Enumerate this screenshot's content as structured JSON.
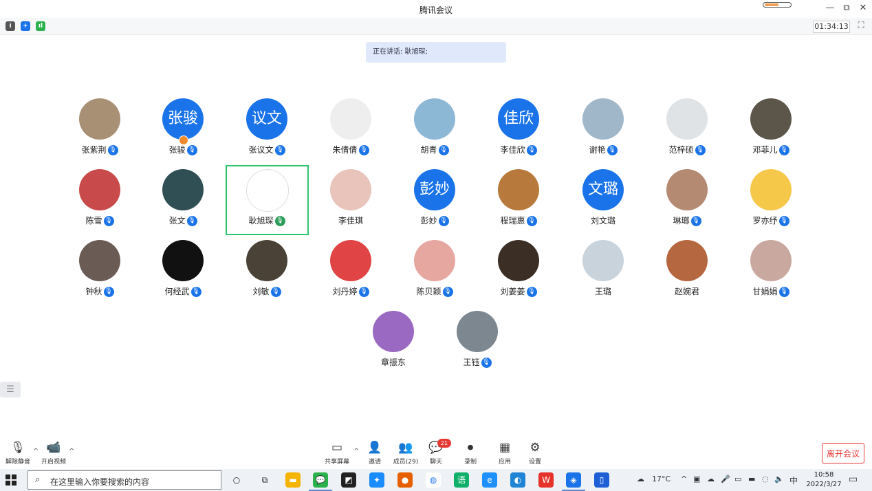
{
  "window": {
    "title": "腾讯会议",
    "controls": {
      "minimize": "—",
      "restore": "⧉",
      "close": "✕"
    }
  },
  "info_bar": {
    "icons": [
      {
        "name": "info-icon",
        "glyph": "i",
        "color": "#555555"
      },
      {
        "name": "shield-icon",
        "glyph": "+",
        "color": "#1a73e8"
      },
      {
        "name": "signal-icon",
        "glyph": "ıl",
        "color": "#2bb24c"
      }
    ],
    "timer": "01:34:13",
    "fullscreen_glyph": "⛶"
  },
  "speaking_banner": "正在讲话: 耿旭琛;",
  "participants": [
    {
      "name": "张紫荆",
      "avatar_text": "",
      "color": "#a89074",
      "mic": true
    },
    {
      "name": "张骏",
      "avatar_text": "张骏",
      "color": "#1a73e8",
      "mic": true,
      "host": true
    },
    {
      "name": "张议文",
      "avatar_text": "议文",
      "color": "#1a73e8",
      "mic": true
    },
    {
      "name": "朱倩倩",
      "avatar_text": "",
      "color": "#eeeeee",
      "mic": true
    },
    {
      "name": "胡青",
      "avatar_text": "",
      "color": "#8cb8d6",
      "mic": true
    },
    {
      "name": "李佳欣",
      "avatar_text": "佳欣",
      "color": "#1a73e8",
      "mic": true
    },
    {
      "name": "谢艳",
      "avatar_text": "",
      "color": "#9fb7c9",
      "mic": true
    },
    {
      "name": "范梓硕",
      "avatar_text": "",
      "color": "#dfe3e6",
      "mic": true
    },
    {
      "name": "邓菲儿",
      "avatar_text": "",
      "color": "#5b5649",
      "mic": true
    },
    {
      "name": "陈雪",
      "avatar_text": "",
      "color": "#c94a4a",
      "mic": true
    },
    {
      "name": "张文",
      "avatar_text": "",
      "color": "#2f4f55",
      "mic": true
    },
    {
      "name": "耿旭琛",
      "avatar_text": "",
      "color": "#ffffff",
      "mic": true,
      "speaking": true
    },
    {
      "name": "李佳琪",
      "avatar_text": "",
      "color": "#e8c4bb",
      "mic": false
    },
    {
      "name": "彭妙",
      "avatar_text": "彭妙",
      "color": "#1a73e8",
      "mic": true
    },
    {
      "name": "程瑞惠",
      "avatar_text": "",
      "color": "#b87a3c",
      "mic": true
    },
    {
      "name": "刘文璐",
      "avatar_text": "文璐",
      "color": "#1a73e8",
      "mic": false
    },
    {
      "name": "琳瑯",
      "avatar_text": "",
      "color": "#b58a72",
      "mic": true
    },
    {
      "name": "罗亦纾",
      "avatar_text": "",
      "color": "#f5c84a",
      "mic": true
    },
    {
      "name": "钟秋",
      "avatar_text": "",
      "color": "#6b5b55",
      "mic": true
    },
    {
      "name": "何经武",
      "avatar_text": "",
      "color": "#111111",
      "mic": true
    },
    {
      "name": "刘敏",
      "avatar_text": "",
      "color": "#4a4236",
      "mic": true
    },
    {
      "name": "刘丹婷",
      "avatar_text": "",
      "color": "#e04444",
      "mic": true
    },
    {
      "name": "陈贝颖",
      "avatar_text": "",
      "color": "#e6a7a0",
      "mic": true
    },
    {
      "name": "刘姜姜",
      "avatar_text": "",
      "color": "#3a2e25",
      "mic": true
    },
    {
      "name": "王璐",
      "avatar_text": "",
      "color": "#c8d3dc",
      "mic": false
    },
    {
      "name": "赵婉君",
      "avatar_text": "",
      "color": "#b5673f",
      "mic": false
    },
    {
      "name": "甘娟娟",
      "avatar_text": "",
      "color": "#c9a8a0",
      "mic": true
    },
    {
      "name": "章振东",
      "avatar_text": "",
      "color": "#9a6ac2",
      "mic": false
    },
    {
      "name": "王钰",
      "avatar_text": "",
      "color": "#7d8790",
      "mic": true
    }
  ],
  "sidebar_toggle_glyph": "☰",
  "toolbar": {
    "left": [
      {
        "name": "unmute",
        "label": "解除静音",
        "glyph": "🎙"
      },
      {
        "name": "start-video",
        "label": "开启视频",
        "glyph": "📹"
      }
    ],
    "center": [
      {
        "name": "share-screen",
        "label": "共享屏幕",
        "glyph": "▭"
      },
      {
        "name": "invite",
        "label": "邀请",
        "glyph": "👤"
      },
      {
        "name": "members",
        "label": "成员(29)",
        "glyph": "👥"
      },
      {
        "name": "chat",
        "label": "聊天",
        "glyph": "💬",
        "badge": "21"
      },
      {
        "name": "record",
        "label": "录制",
        "glyph": "⏺"
      },
      {
        "name": "apps",
        "label": "应用",
        "glyph": "▦"
      },
      {
        "name": "settings",
        "label": "设置",
        "glyph": "⚙"
      }
    ],
    "leave_label": "离开会议"
  },
  "taskbar": {
    "search_placeholder": "在这里输入你要搜索的内容",
    "apps": [
      {
        "name": "cortana",
        "glyph": "○",
        "color": "#eef1f6",
        "text": "#222222"
      },
      {
        "name": "task-view",
        "glyph": "⧉",
        "color": "#eef1f6",
        "text": "#222222"
      },
      {
        "name": "file-explorer",
        "glyph": "▬",
        "color": "#f4b400"
      },
      {
        "name": "wechat",
        "glyph": "💬",
        "color": "#2bb24c",
        "active": true
      },
      {
        "name": "sticky-notes",
        "glyph": "◩",
        "color": "#222222"
      },
      {
        "name": "dingtalk",
        "glyph": "✦",
        "color": "#1a8cff"
      },
      {
        "name": "firefox",
        "glyph": "●",
        "color": "#e66000"
      },
      {
        "name": "baidu-netdisk",
        "glyph": "◍",
        "color": "#ffffff",
        "text": "#2b7de9"
      },
      {
        "name": "yuque",
        "glyph": "语",
        "color": "#10b06a"
      },
      {
        "name": "ie-browser",
        "glyph": "e",
        "color": "#1e90ff"
      },
      {
        "name": "edge",
        "glyph": "◐",
        "color": "#1f84d6"
      },
      {
        "name": "wps",
        "glyph": "W",
        "color": "#e5332a"
      },
      {
        "name": "tencent-meeting",
        "glyph": "◈",
        "color": "#1a73e8",
        "active": true
      },
      {
        "name": "notes-app",
        "glyph": "▯",
        "color": "#1f5fd6"
      }
    ],
    "weather": "17°C",
    "tray_icons": [
      "^",
      "▣",
      "☁",
      "🎤",
      "▭",
      "▬",
      "◌",
      "🔈"
    ],
    "ime": "中",
    "time": "10:58",
    "date": "2022/3/27"
  }
}
